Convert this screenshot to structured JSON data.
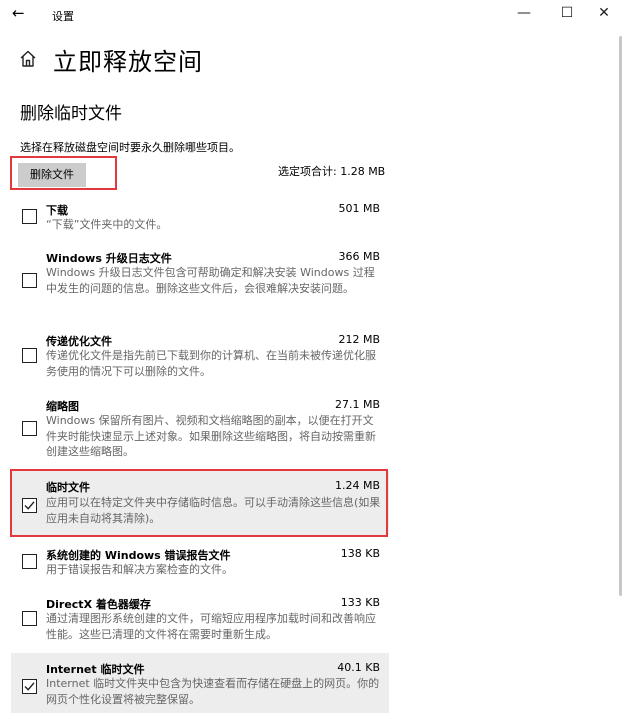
{
  "window": {
    "app_title": "设置",
    "back_icon": "arrow-left-icon",
    "controls": [
      "minimize-icon",
      "maximize-icon",
      "close-icon"
    ]
  },
  "page": {
    "title": "立即释放空间",
    "home_icon": "home-icon",
    "section_title": "删除临时文件",
    "description": "选择在释放磁盘空间时要永久删除哪些项目。",
    "delete_button": "删除文件",
    "selected_total": "选定项合计: 1.28 MB"
  },
  "items": [
    {
      "name": "下载",
      "size": "501 MB",
      "checked": false,
      "desc": "“下载”文件夹中的文件。"
    },
    {
      "name": "Windows 升级日志文件",
      "size": "366 MB",
      "checked": false,
      "desc": "Windows 升级日志文件包含可帮助确定和解决安装 Windows 过程中发生的问题的信息。删除这些文件后，会很难解决安装问题。"
    },
    {
      "name": "传递优化文件",
      "size": "212 MB",
      "checked": false,
      "desc": "传递优化文件是指先前已下载到你的计算机、在当前未被传递优化服务使用的情况下可以删除的文件。"
    },
    {
      "name": "缩略图",
      "size": "27.1 MB",
      "checked": false,
      "desc": "Windows 保留所有图片、视频和文档缩略图的副本，以便在打开文件夹时能快速显示上述对象。如果删除这些缩略图，将自动按需重新创建这些缩略图。"
    },
    {
      "name": "临时文件",
      "size": "1.24 MB",
      "checked": true,
      "desc": "应用可以在特定文件夹中存储临时信息。可以手动清除这些信息(如果应用未自动将其清除)。"
    },
    {
      "name": "系统创建的 Windows 错误报告文件",
      "size": "138 KB",
      "checked": false,
      "desc": "用于错误报告和解决方案检查的文件。"
    },
    {
      "name": "DirectX 着色器缓存",
      "size": "133 KB",
      "checked": false,
      "desc": "通过清理图形系统创建的文件，可缩短应用程序加载时间和改善响应性能。这些已清理的文件将在需要时重新生成。"
    },
    {
      "name": "Internet 临时文件",
      "size": "40.1 KB",
      "checked": true,
      "desc": "Internet 临时文件夹中包含为快速查看而存储在硬盘上的网页。你的网页个性化设置将被完整保留。"
    }
  ],
  "colors": {
    "highlight": "#e3393c",
    "selected_bg": "#ededed",
    "button_bg": "#cccccc"
  }
}
